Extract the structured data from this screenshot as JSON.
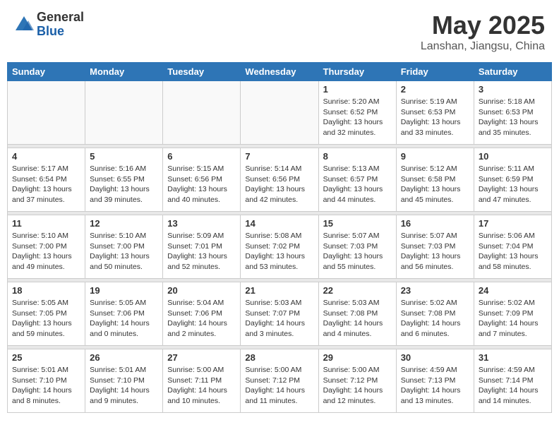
{
  "header": {
    "logo_general": "General",
    "logo_blue": "Blue",
    "month_title": "May 2025",
    "location": "Lanshan, Jiangsu, China"
  },
  "weekdays": [
    "Sunday",
    "Monday",
    "Tuesday",
    "Wednesday",
    "Thursday",
    "Friday",
    "Saturday"
  ],
  "weeks": [
    [
      {
        "day": "",
        "info": ""
      },
      {
        "day": "",
        "info": ""
      },
      {
        "day": "",
        "info": ""
      },
      {
        "day": "",
        "info": ""
      },
      {
        "day": "1",
        "info": "Sunrise: 5:20 AM\nSunset: 6:52 PM\nDaylight: 13 hours\nand 32 minutes."
      },
      {
        "day": "2",
        "info": "Sunrise: 5:19 AM\nSunset: 6:53 PM\nDaylight: 13 hours\nand 33 minutes."
      },
      {
        "day": "3",
        "info": "Sunrise: 5:18 AM\nSunset: 6:53 PM\nDaylight: 13 hours\nand 35 minutes."
      }
    ],
    [
      {
        "day": "4",
        "info": "Sunrise: 5:17 AM\nSunset: 6:54 PM\nDaylight: 13 hours\nand 37 minutes."
      },
      {
        "day": "5",
        "info": "Sunrise: 5:16 AM\nSunset: 6:55 PM\nDaylight: 13 hours\nand 39 minutes."
      },
      {
        "day": "6",
        "info": "Sunrise: 5:15 AM\nSunset: 6:56 PM\nDaylight: 13 hours\nand 40 minutes."
      },
      {
        "day": "7",
        "info": "Sunrise: 5:14 AM\nSunset: 6:56 PM\nDaylight: 13 hours\nand 42 minutes."
      },
      {
        "day": "8",
        "info": "Sunrise: 5:13 AM\nSunset: 6:57 PM\nDaylight: 13 hours\nand 44 minutes."
      },
      {
        "day": "9",
        "info": "Sunrise: 5:12 AM\nSunset: 6:58 PM\nDaylight: 13 hours\nand 45 minutes."
      },
      {
        "day": "10",
        "info": "Sunrise: 5:11 AM\nSunset: 6:59 PM\nDaylight: 13 hours\nand 47 minutes."
      }
    ],
    [
      {
        "day": "11",
        "info": "Sunrise: 5:10 AM\nSunset: 7:00 PM\nDaylight: 13 hours\nand 49 minutes."
      },
      {
        "day": "12",
        "info": "Sunrise: 5:10 AM\nSunset: 7:00 PM\nDaylight: 13 hours\nand 50 minutes."
      },
      {
        "day": "13",
        "info": "Sunrise: 5:09 AM\nSunset: 7:01 PM\nDaylight: 13 hours\nand 52 minutes."
      },
      {
        "day": "14",
        "info": "Sunrise: 5:08 AM\nSunset: 7:02 PM\nDaylight: 13 hours\nand 53 minutes."
      },
      {
        "day": "15",
        "info": "Sunrise: 5:07 AM\nSunset: 7:03 PM\nDaylight: 13 hours\nand 55 minutes."
      },
      {
        "day": "16",
        "info": "Sunrise: 5:07 AM\nSunset: 7:03 PM\nDaylight: 13 hours\nand 56 minutes."
      },
      {
        "day": "17",
        "info": "Sunrise: 5:06 AM\nSunset: 7:04 PM\nDaylight: 13 hours\nand 58 minutes."
      }
    ],
    [
      {
        "day": "18",
        "info": "Sunrise: 5:05 AM\nSunset: 7:05 PM\nDaylight: 13 hours\nand 59 minutes."
      },
      {
        "day": "19",
        "info": "Sunrise: 5:05 AM\nSunset: 7:06 PM\nDaylight: 14 hours\nand 0 minutes."
      },
      {
        "day": "20",
        "info": "Sunrise: 5:04 AM\nSunset: 7:06 PM\nDaylight: 14 hours\nand 2 minutes."
      },
      {
        "day": "21",
        "info": "Sunrise: 5:03 AM\nSunset: 7:07 PM\nDaylight: 14 hours\nand 3 minutes."
      },
      {
        "day": "22",
        "info": "Sunrise: 5:03 AM\nSunset: 7:08 PM\nDaylight: 14 hours\nand 4 minutes."
      },
      {
        "day": "23",
        "info": "Sunrise: 5:02 AM\nSunset: 7:08 PM\nDaylight: 14 hours\nand 6 minutes."
      },
      {
        "day": "24",
        "info": "Sunrise: 5:02 AM\nSunset: 7:09 PM\nDaylight: 14 hours\nand 7 minutes."
      }
    ],
    [
      {
        "day": "25",
        "info": "Sunrise: 5:01 AM\nSunset: 7:10 PM\nDaylight: 14 hours\nand 8 minutes."
      },
      {
        "day": "26",
        "info": "Sunrise: 5:01 AM\nSunset: 7:10 PM\nDaylight: 14 hours\nand 9 minutes."
      },
      {
        "day": "27",
        "info": "Sunrise: 5:00 AM\nSunset: 7:11 PM\nDaylight: 14 hours\nand 10 minutes."
      },
      {
        "day": "28",
        "info": "Sunrise: 5:00 AM\nSunset: 7:12 PM\nDaylight: 14 hours\nand 11 minutes."
      },
      {
        "day": "29",
        "info": "Sunrise: 5:00 AM\nSunset: 7:12 PM\nDaylight: 14 hours\nand 12 minutes."
      },
      {
        "day": "30",
        "info": "Sunrise: 4:59 AM\nSunset: 7:13 PM\nDaylight: 14 hours\nand 13 minutes."
      },
      {
        "day": "31",
        "info": "Sunrise: 4:59 AM\nSunset: 7:14 PM\nDaylight: 14 hours\nand 14 minutes."
      }
    ]
  ]
}
